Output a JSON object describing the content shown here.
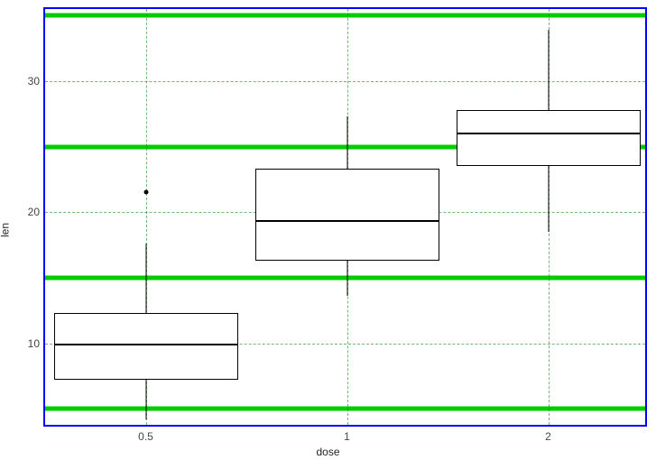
{
  "chart_data": {
    "type": "boxplot",
    "title": "",
    "xlabel": "dose",
    "ylabel": "len",
    "ylim": [
      3.5,
      35.5
    ],
    "y_ticks": [
      10,
      20,
      30
    ],
    "y_major_lines": [
      5,
      15,
      25,
      35
    ],
    "y_minor_lines": [
      10,
      20,
      30
    ],
    "x_minor_lines": [
      0.5,
      1.5,
      2.5
    ],
    "categories": [
      "0.5",
      "1",
      "2"
    ],
    "series": [
      {
        "category": "0.5",
        "lower_whisker": 4.2,
        "q1": 7.2,
        "median": 9.9,
        "q3": 12.3,
        "upper_whisker": 17.6,
        "outliers": [
          21.5
        ]
      },
      {
        "category": "1",
        "lower_whisker": 13.6,
        "q1": 16.3,
        "median": 19.3,
        "q3": 23.3,
        "upper_whisker": 27.3,
        "outliers": []
      },
      {
        "category": "2",
        "lower_whisker": 18.5,
        "q1": 23.5,
        "median": 26.0,
        "q3": 27.8,
        "upper_whisker": 33.9,
        "outliers": []
      }
    ],
    "panel_border_color": "#0000ff",
    "major_grid_color": "#00cc00",
    "minor_grid_dashed": true,
    "box_width_fraction": 0.305
  }
}
